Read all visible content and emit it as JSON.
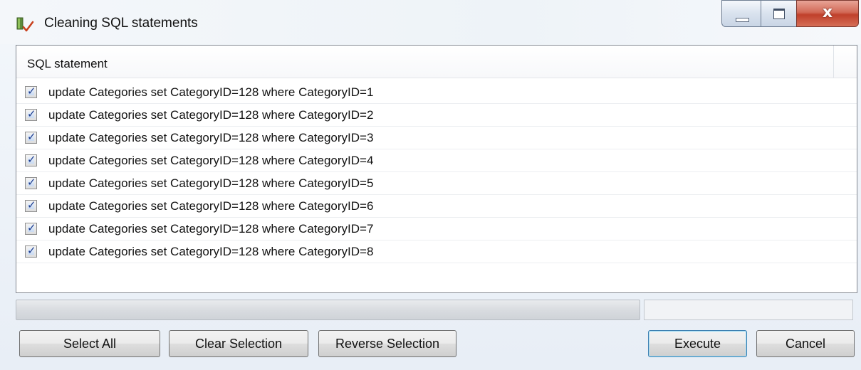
{
  "window": {
    "title": "Cleaning SQL statements",
    "app_icon": "database-check-icon",
    "controls": {
      "minimize": "minimize-icon",
      "maximize": "maximize-icon",
      "close_glyph": "x",
      "close_icon": "close-icon"
    }
  },
  "list": {
    "column_header": "SQL statement",
    "rows": [
      {
        "checked": true,
        "text": "update Categories set CategoryID=128 where CategoryID=1"
      },
      {
        "checked": true,
        "text": "update Categories set CategoryID=128 where CategoryID=2"
      },
      {
        "checked": true,
        "text": "update Categories set CategoryID=128 where CategoryID=3"
      },
      {
        "checked": true,
        "text": "update Categories set CategoryID=128 where CategoryID=4"
      },
      {
        "checked": true,
        "text": "update Categories set CategoryID=128 where CategoryID=5"
      },
      {
        "checked": true,
        "text": "update Categories set CategoryID=128 where CategoryID=6"
      },
      {
        "checked": true,
        "text": "update Categories set CategoryID=128 where CategoryID=7"
      },
      {
        "checked": true,
        "text": "update Categories set CategoryID=128 where CategoryID=8"
      }
    ]
  },
  "progress": {
    "value": 0,
    "status_text": ""
  },
  "buttons": {
    "select_all": "Select All",
    "clear_selection": "Clear Selection",
    "reverse_selection": "Reverse Selection",
    "execute": "Execute",
    "cancel": "Cancel"
  },
  "colors": {
    "accent": "#3c7fb1",
    "close_button": "#c0402b",
    "checkbox_mark": "#1d3d8f"
  }
}
